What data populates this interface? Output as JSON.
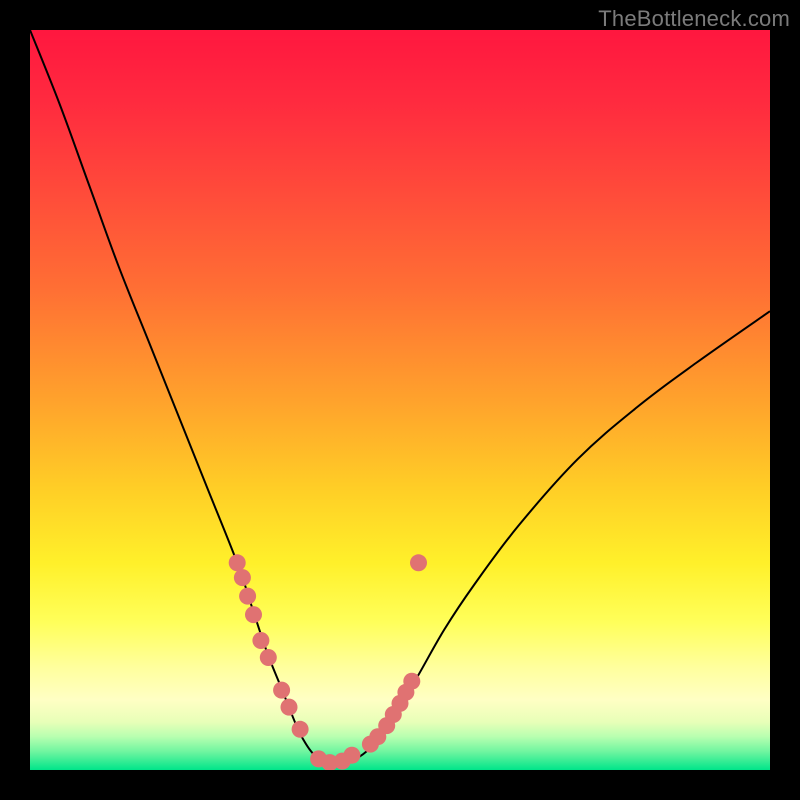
{
  "watermark": "TheBottleneck.com",
  "colors": {
    "frame": "#000000",
    "curve_stroke": "#000000",
    "dot_fill": "#e07272",
    "dot_stroke": "#d06060",
    "gradient_stops": [
      {
        "offset": 0.0,
        "color": "#ff173f"
      },
      {
        "offset": 0.1,
        "color": "#ff2b3f"
      },
      {
        "offset": 0.22,
        "color": "#ff4b3a"
      },
      {
        "offset": 0.35,
        "color": "#ff6f34"
      },
      {
        "offset": 0.5,
        "color": "#ffa22c"
      },
      {
        "offset": 0.62,
        "color": "#ffce26"
      },
      {
        "offset": 0.72,
        "color": "#fff02a"
      },
      {
        "offset": 0.8,
        "color": "#ffff5a"
      },
      {
        "offset": 0.86,
        "color": "#ffff9c"
      },
      {
        "offset": 0.905,
        "color": "#ffffc4"
      },
      {
        "offset": 0.935,
        "color": "#e8ffb8"
      },
      {
        "offset": 0.955,
        "color": "#b8ffb0"
      },
      {
        "offset": 0.975,
        "color": "#70f5a0"
      },
      {
        "offset": 1.0,
        "color": "#00e58a"
      }
    ]
  },
  "chart_data": {
    "type": "line",
    "title": "",
    "xlabel": "",
    "ylabel": "",
    "xlim": [
      0,
      100
    ],
    "ylim": [
      0,
      100
    ],
    "series": [
      {
        "name": "bottleneck-curve",
        "x": [
          0,
          4,
          8,
          12,
          16,
          20,
          24,
          28,
          30,
          32,
          34,
          36,
          37,
          38,
          39,
          40,
          42,
          44,
          46,
          48,
          52,
          56,
          60,
          66,
          74,
          82,
          90,
          100
        ],
        "y": [
          100,
          90,
          79,
          68,
          58,
          48,
          38,
          28,
          22,
          16,
          11,
          6,
          4,
          2.5,
          1.5,
          1,
          1,
          1.5,
          3,
          5.5,
          12,
          19,
          25,
          33,
          42,
          49,
          55,
          62
        ]
      }
    ],
    "dots": {
      "name": "highlight-dots",
      "x": [
        28,
        28.7,
        29.4,
        30.2,
        31.2,
        32.2,
        34.0,
        35.0,
        36.5,
        39.0,
        40.5,
        42.2,
        43.5,
        46.0,
        47.0,
        48.2,
        49.1,
        50.0,
        50.8,
        51.6,
        52.5
      ],
      "y": [
        28.0,
        26.0,
        23.5,
        21.0,
        17.5,
        15.2,
        10.8,
        8.5,
        5.5,
        1.5,
        1.0,
        1.2,
        2.0,
        3.5,
        4.5,
        6.0,
        7.5,
        9.0,
        10.5,
        12.0,
        28.0
      ]
    }
  }
}
